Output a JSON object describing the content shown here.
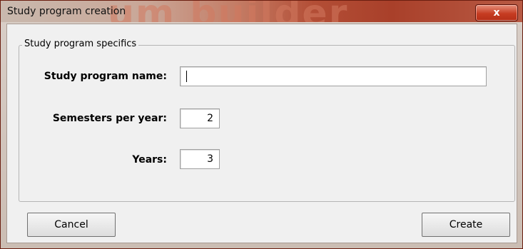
{
  "window": {
    "title": "Study program creation",
    "watermark": "um builder",
    "close_glyph": "x"
  },
  "group": {
    "legend": "Study program specifics"
  },
  "fields": {
    "name_label": "Study program name:",
    "name_value": "",
    "semesters_label": "Semesters per year:",
    "semesters_value": "2",
    "years_label": "Years:",
    "years_value": "3"
  },
  "buttons": {
    "cancel": "Cancel",
    "create": "Create"
  }
}
